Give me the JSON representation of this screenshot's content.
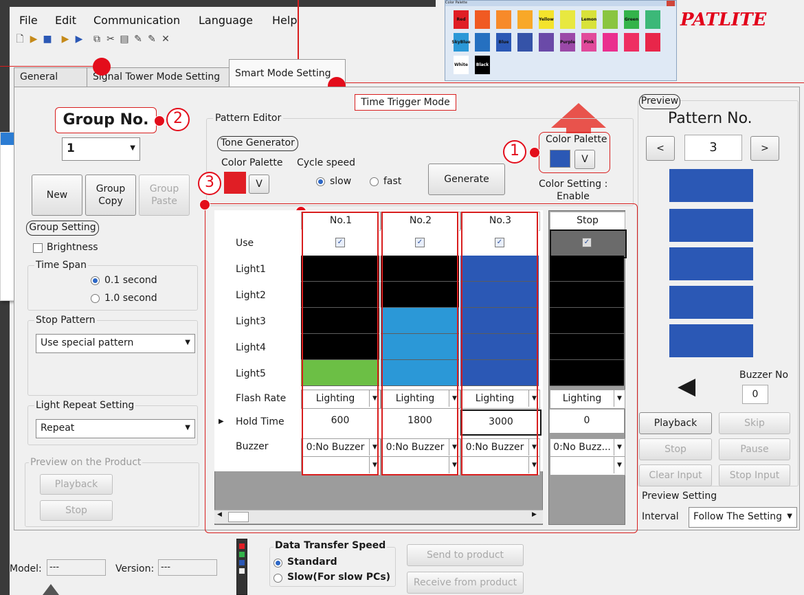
{
  "menu": [
    "File",
    "Edit",
    "Communication",
    "Language",
    "Help"
  ],
  "logo": "PATLITE",
  "palette_popup": {
    "title": "Color Palette",
    "colors": [
      {
        "name": "Red",
        "hex": "#e01e25"
      },
      {
        "name": "",
        "hex": "#f05a22"
      },
      {
        "name": "",
        "hex": "#f78a2a"
      },
      {
        "name": "",
        "hex": "#f8a828"
      },
      {
        "name": "Yellow",
        "hex": "#f4e32c"
      },
      {
        "name": "",
        "hex": "#e8e840"
      },
      {
        "name": "Lemon",
        "hex": "#d8e23a"
      },
      {
        "name": "",
        "hex": "#8ac540"
      },
      {
        "name": "Green",
        "hex": "#34b34a"
      },
      {
        "name": "",
        "hex": "#3cb878"
      },
      {
        "name": "SkyBlue",
        "hex": "#2b98d7"
      },
      {
        "name": "",
        "hex": "#2570c0"
      },
      {
        "name": "Blue",
        "hex": "#2b58b5"
      },
      {
        "name": "",
        "hex": "#3553a8"
      },
      {
        "name": "",
        "hex": "#6a4aa8"
      },
      {
        "name": "Purple",
        "hex": "#9b49a8"
      },
      {
        "name": "Pink",
        "hex": "#e14a9b"
      },
      {
        "name": "",
        "hex": "#ea2f8f"
      },
      {
        "name": "",
        "hex": "#ee2e62"
      },
      {
        "name": "",
        "hex": "#e8264a"
      },
      {
        "name": "White",
        "hex": "#ffffff"
      },
      {
        "name": "Black",
        "hex": "#000000"
      }
    ]
  },
  "tabs": [
    "General Setting",
    "Signal Tower Mode Setting",
    "Smart Mode Setting"
  ],
  "mode_label": "Time Trigger Mode",
  "group": {
    "title": "Group No.",
    "value": "1",
    "new": "New",
    "copy": "Group\nCopy",
    "paste": "Group\nPaste"
  },
  "group_setting": {
    "title": "Group Setting",
    "brightness": "Brightness",
    "time_span": "Time Span",
    "opt1": "0.1 second",
    "opt2": "1.0 second"
  },
  "stop_pattern": {
    "title": "Stop Pattern",
    "value": "Use special pattern"
  },
  "light_repeat": {
    "title": "Light Repeat Setting",
    "value": "Repeat"
  },
  "preview_product": {
    "title": "Preview on the Product",
    "playback": "Playback",
    "stop": "Stop"
  },
  "pattern_editor": {
    "title": "Pattern Editor",
    "tone": "Tone Generator",
    "color_palette": "Color Palette",
    "v": "V",
    "cycle": "Cycle speed",
    "slow": "slow",
    "fast": "fast",
    "generate": "Generate",
    "color_setting": "Color Setting :\nEnable"
  },
  "badges": [
    "1",
    "2",
    "3"
  ],
  "grid": {
    "headers": [
      "No.1",
      "No.2",
      "No.3",
      "Stop"
    ],
    "rows": [
      "Use",
      "Light1",
      "Light2",
      "Light3",
      "Light4",
      "Light5",
      "Flash Rate",
      "Hold Time",
      "Buzzer"
    ],
    "lights": [
      [
        "#000000",
        "#000000",
        "#000000",
        "#000000",
        "#6cbf45"
      ],
      [
        "#000000",
        "#000000",
        "#2b98d7",
        "#2b98d7",
        "#2b98d7"
      ],
      [
        "#2b58b5",
        "#2b58b5",
        "#2b58b5",
        "#2b58b5",
        "#2b58b5"
      ],
      [
        "#000000",
        "#000000",
        "#000000",
        "#000000",
        "#000000"
      ]
    ],
    "flash": [
      "Lighting",
      "Lighting",
      "Lighting",
      "Lighting"
    ],
    "hold": [
      "600",
      "1800",
      "3000",
      "0"
    ],
    "buzzer": [
      "0:No Buzzer",
      "0:No Buzzer",
      "0:No Buzzer",
      "0:No Buzz..."
    ]
  },
  "preview": {
    "title": "Preview",
    "pattern": "Pattern No.",
    "prev": "<",
    "next": ">",
    "value": "3",
    "buzzer_no": "Buzzer No",
    "buzzer_val": "0",
    "playback": "Playback",
    "skip": "Skip",
    "stop": "Stop",
    "pause": "Pause",
    "clear": "Clear Input",
    "stop_input": "Stop Input",
    "setting": "Preview Setting",
    "interval": "Interval",
    "interval_val": "Follow The Setting"
  },
  "bottom": {
    "model": "Model:",
    "model_val": "---",
    "version": "Version:",
    "version_val": "---",
    "speed_title": "Data Transfer Speed",
    "standard": "Standard",
    "slow_pc": "Slow(For slow PCs)",
    "send": "Send to product",
    "receive": "Receive from product"
  }
}
